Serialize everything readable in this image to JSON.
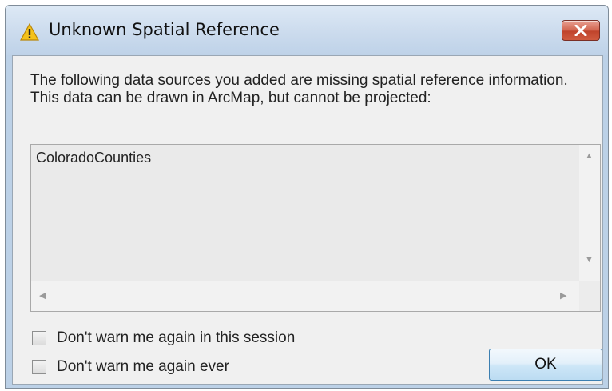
{
  "dialog": {
    "title": "Unknown Spatial Reference",
    "message": "The following data sources you added are missing spatial reference information. This data can be drawn in ArcMap, but cannot be projected:",
    "list_items": [
      "ColoradoCounties"
    ],
    "checkbox_session_label": "Don't warn me again in this session",
    "checkbox_ever_label": "Don't warn me again ever",
    "checkbox_session_checked": false,
    "checkbox_ever_checked": false,
    "ok_label": "OK",
    "title_icon": "warning-icon",
    "close_icon": "close-icon"
  }
}
